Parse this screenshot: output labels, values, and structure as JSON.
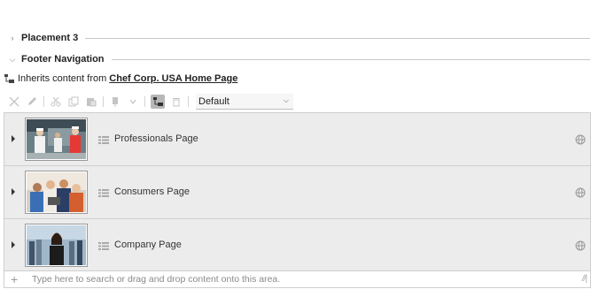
{
  "sections": [
    {
      "title": "Placement 3",
      "expanded": false
    },
    {
      "title": "Footer Navigation",
      "expanded": true
    }
  ],
  "inherits": {
    "prefix": "Inherits content from",
    "link": "Chef Corp. USA Home Page"
  },
  "toolbar": {
    "icons": [
      "close-icon",
      "edit-icon",
      "cut-icon",
      "copy-icon",
      "paste-icon",
      "insert-icon",
      "chevron-down-icon",
      "inherit-icon",
      "delete-icon"
    ],
    "select_value": "Default"
  },
  "items": [
    {
      "label": "Professionals Page"
    },
    {
      "label": "Consumers Page"
    },
    {
      "label": "Company Page"
    }
  ],
  "add": {
    "placeholder": "Type here to search or drag and drop content onto this area."
  },
  "colors": {
    "row_bg": "#ececec",
    "border": "#cfcfcf",
    "disabled_icon": "#c4c4c4",
    "active_icon_bg": "#b8b8b8"
  }
}
